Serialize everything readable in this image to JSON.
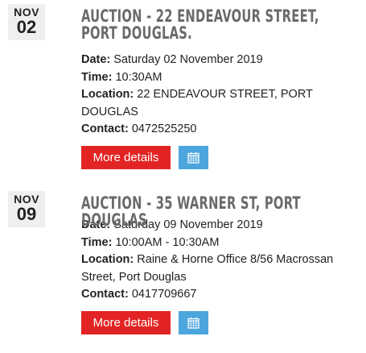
{
  "events": [
    {
      "month": "NOV",
      "day": "02",
      "title": "AUCTION - 22 ENDEAVOUR STREET, PORT DOUGLAS.",
      "date_label": "Date:",
      "date_value": "Saturday 02 November 2019",
      "time_label": "Time:",
      "time_value": "10:30AM",
      "location_label": "Location:",
      "location_value": "22 ENDEAVOUR STREET, PORT DOUGLAS",
      "contact_label": "Contact:",
      "contact_value": "0472525250",
      "more_label": "More details",
      "calendar_icon": "calendar-icon"
    },
    {
      "month": "NOV",
      "day": "09",
      "title": "AUCTION - 35 WARNER ST, PORT DOUGLAS",
      "date_label": "Date:",
      "date_value": "Saturday 09 November 2019",
      "time_label": "Time:",
      "time_value": "10:00AM - 10:30AM",
      "location_label": "Location:",
      "location_value": "Raine & Horne Office 8/56 Macrossan Street, Port Douglas",
      "contact_label": "Contact:",
      "contact_value": "0417709667",
      "more_label": "More details",
      "calendar_icon": "calendar-icon"
    }
  ],
  "colors": {
    "more_button": "#e32424",
    "calendar_button": "#4ca6dd",
    "title": "#6a6a6a",
    "badge_bg": "#efefef"
  }
}
